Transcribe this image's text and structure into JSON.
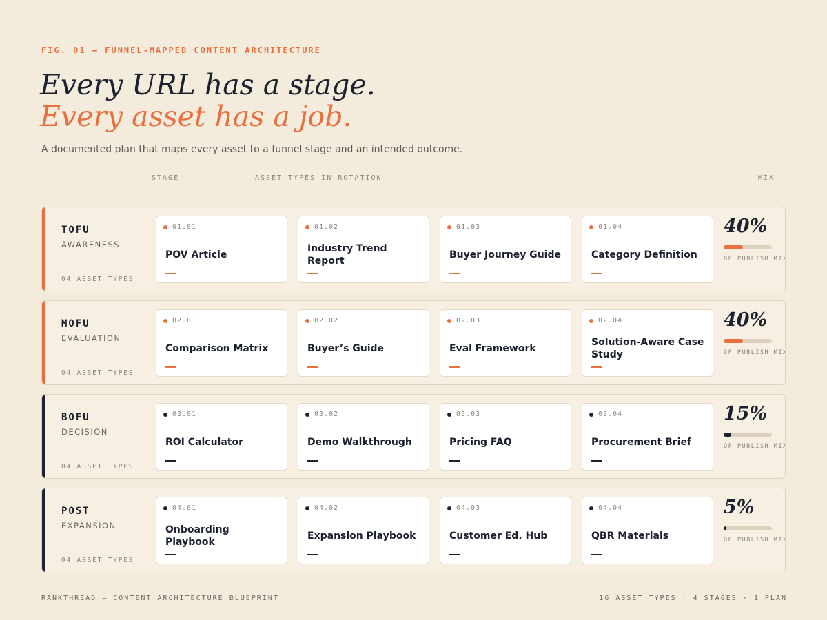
{
  "eyebrow": "FIG. 01 — FUNNEL-MAPPED CONTENT ARCHITECTURE",
  "headline": {
    "line1": "Every URL has a stage.",
    "line2": "Every asset has a job."
  },
  "subtitle": "A documented plan that maps every asset to a funnel stage and an intended outcome.",
  "columns": {
    "stage": "STAGE",
    "assets": "ASSET TYPES IN ROTATION",
    "mix": "MIX"
  },
  "colors": {
    "accent": "#e8703f",
    "ink": "#1c2130",
    "background": "#f3ebdb"
  },
  "stages": [
    {
      "code": "TOFU",
      "name": "AWARENESS",
      "count": "04 ASSET TYPES",
      "accent": "#e8703f",
      "mix_label": "40%",
      "mix_value": 0.4,
      "mix_caption": "OF PUBLISH MIX",
      "assets": [
        {
          "num": "01.01",
          "title": "POV Article"
        },
        {
          "num": "01.02",
          "title": "Industry Trend Report"
        },
        {
          "num": "01.03",
          "title": "Buyer Journey Guide"
        },
        {
          "num": "01.04",
          "title": "Category Definition"
        }
      ]
    },
    {
      "code": "MOFU",
      "name": "EVALUATION",
      "count": "04 ASSET TYPES",
      "accent": "#e8703f",
      "mix_label": "40%",
      "mix_value": 0.4,
      "mix_caption": "OF PUBLISH MIX",
      "assets": [
        {
          "num": "02.01",
          "title": "Comparison Matrix"
        },
        {
          "num": "02.02",
          "title": "Buyer’s Guide"
        },
        {
          "num": "02.03",
          "title": "Eval Framework"
        },
        {
          "num": "02.04",
          "title": "Solution-Aware Case Study"
        }
      ]
    },
    {
      "code": "BOFU",
      "name": "DECISION",
      "count": "04 ASSET TYPES",
      "accent": "#1c2130",
      "mix_label": "15%",
      "mix_value": 0.15,
      "mix_caption": "OF PUBLISH MIX",
      "assets": [
        {
          "num": "03.01",
          "title": "ROI Calculator"
        },
        {
          "num": "03.02",
          "title": "Demo Walkthrough"
        },
        {
          "num": "03.03",
          "title": "Pricing FAQ"
        },
        {
          "num": "03.04",
          "title": "Procurement Brief"
        }
      ]
    },
    {
      "code": "POST",
      "name": "EXPANSION",
      "count": "04 ASSET TYPES",
      "accent": "#1c2130",
      "mix_label": "5%",
      "mix_value": 0.05,
      "mix_caption": "OF PUBLISH MIX",
      "assets": [
        {
          "num": "04.01",
          "title": "Onboarding Playbook"
        },
        {
          "num": "04.02",
          "title": "Expansion Playbook"
        },
        {
          "num": "04.03",
          "title": "Customer Ed. Hub"
        },
        {
          "num": "04.04",
          "title": "QBR Materials"
        }
      ]
    }
  ],
  "footer": {
    "left": "RANKTHREAD — CONTENT ARCHITECTURE BLUEPRINT",
    "right": "16 ASSET TYPES · 4 STAGES · 1 PLAN"
  }
}
